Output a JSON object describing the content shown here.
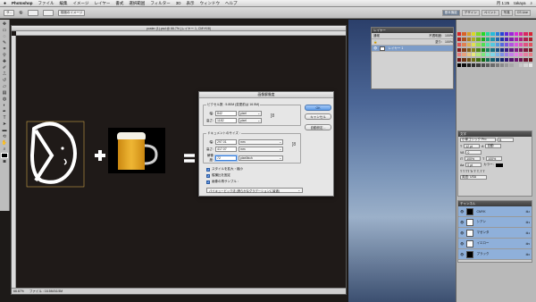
{
  "menubar": {
    "apple": "",
    "items": [
      "Photoshop",
      "ファイル",
      "編集",
      "イメージ",
      "レイヤー",
      "書式",
      "選択範囲",
      "フィルター",
      "3D",
      "表示",
      "ウィンドウ",
      "ヘルプ"
    ],
    "right_items": [
      "月 1:25",
      "takaya"
    ]
  },
  "options_bar": {
    "preset_label": "サ...",
    "mode_label": "幅:",
    "button": "前面のイメージ",
    "workspace_items": [
      "基本機能",
      "デザイン",
      "ペイント",
      "写真",
      "CS Live"
    ]
  },
  "document": {
    "title": "poster (1).psd @ 66.7% (レイヤー 1, CMYK/8)",
    "zoom": "66.67%",
    "status": "ファイル : 16.5M/16.5M"
  },
  "layers_panel": {
    "tabs": [
      "レイヤー",
      "チャンネル",
      "パス"
    ],
    "blend_mode": "通常",
    "opacity_label": "不透明度:",
    "opacity": "100%",
    "fill_label": "塗り:",
    "fill": "100%",
    "layer_name": "レイヤー 1"
  },
  "char_panel": {
    "title": "文字",
    "font": "小塚ゴシック Pro",
    "style": "B",
    "size": "12 pt",
    "leading": "自動",
    "tracking": "0",
    "scale_v": "100%",
    "scale_h": "100%",
    "baseline": "0 pt",
    "color_label": "カラー:",
    "lang": "英語: USA"
  },
  "channels_panel": {
    "title": "チャンネル",
    "rows": [
      {
        "name": "CMYK",
        "key": "⌘2"
      },
      {
        "name": "シアン",
        "key": "⌘3"
      },
      {
        "name": "マゼンタ",
        "key": "⌘4"
      },
      {
        "name": "イエロー",
        "key": "⌘5"
      },
      {
        "name": "ブラック",
        "key": "⌘6"
      }
    ]
  },
  "dialog": {
    "title": "画像解像度",
    "pixel_size_label": "ピクセル数 : 5.80M (変更前は 16.5M)",
    "width_label": "幅:",
    "width_value": "842",
    "width_unit": "pixel",
    "height_label": "高さ:",
    "height_value": "1182",
    "height_unit": "pixel",
    "doc_size_label": "ドキュメントのサイズ :",
    "doc_width_label": "幅:",
    "doc_width_value": "297.01",
    "doc_width_unit": "mm",
    "doc_height_label": "高さ:",
    "doc_height_value": "417.07",
    "doc_height_unit": "mm",
    "resolution_label": "解像度:",
    "resolution_value": "72",
    "resolution_unit": "pixel/inch",
    "ok": "OK",
    "cancel": "キャンセル",
    "auto": "自動設定...",
    "scale_styles": "スタイルを拡大・縮小",
    "constrain": "縦横比を固定",
    "resample": "画像の再サンプル :",
    "resample_method": "バイキュービック法 (滑らかなグラデーションに最適)"
  },
  "colors": {
    "accent": "#5d9be6",
    "canvas_bg": "#1f1a18"
  }
}
